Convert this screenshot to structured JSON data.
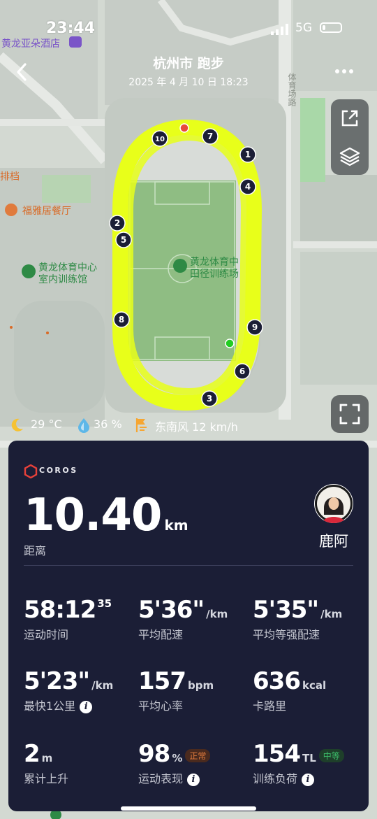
{
  "status_bar": {
    "time": "23:44",
    "network": "5G",
    "battery_level": 0.18
  },
  "header": {
    "title": "杭州市 跑步",
    "subtitle": "2025 年 4 月 10 日 18:23"
  },
  "map": {
    "pois": [
      {
        "label": "黄龙亚朵酒店",
        "kind": "hotel"
      },
      {
        "label": "排档",
        "kind": "food"
      },
      {
        "label": "福雅居餐厅",
        "kind": "food"
      },
      {
        "label": "黄龙体育中心",
        "label2": "室内训练馆",
        "kind": "venue"
      },
      {
        "label": "黄龙体育中",
        "label2": "田径训练场",
        "kind": "venue"
      }
    ],
    "road_label": "体育场路",
    "lap_markers": [
      "10",
      "7",
      "1",
      "4",
      "2",
      "5",
      "8",
      "9",
      "6",
      "3"
    ],
    "colors": {
      "track": "#e8ff1a",
      "start": "#22cc22",
      "end": "#e84a3a"
    }
  },
  "weather": {
    "temperature": "29 °C",
    "humidity": "36 %",
    "wind": "东南风 12 km/h"
  },
  "card": {
    "brand": "COROS",
    "distance": {
      "value": "10.40",
      "unit": "km",
      "label": "距离"
    },
    "user": {
      "name": "鹿阿"
    },
    "stats": [
      {
        "value": "58:12",
        "sup": "35",
        "unit": "",
        "label": "运动时间"
      },
      {
        "value": "5'36\"",
        "unit": "/km",
        "label": "平均配速"
      },
      {
        "value": "5'35\"",
        "unit": "/km",
        "label": "平均等强配速"
      },
      {
        "value": "5'23\"",
        "unit": "/km",
        "label": "最快1公里"
      },
      {
        "value": "157",
        "unit": "bpm",
        "label": "平均心率"
      },
      {
        "value": "636",
        "unit": "kcal",
        "label": "卡路里"
      },
      {
        "value": "2",
        "unit": "m",
        "label": "累计上升"
      },
      {
        "value": "98",
        "unit": "%",
        "badge": "正常",
        "label": "运动表现"
      },
      {
        "value": "154",
        "unit": "TL",
        "badge": "中等",
        "label": "训练负荷"
      }
    ]
  }
}
